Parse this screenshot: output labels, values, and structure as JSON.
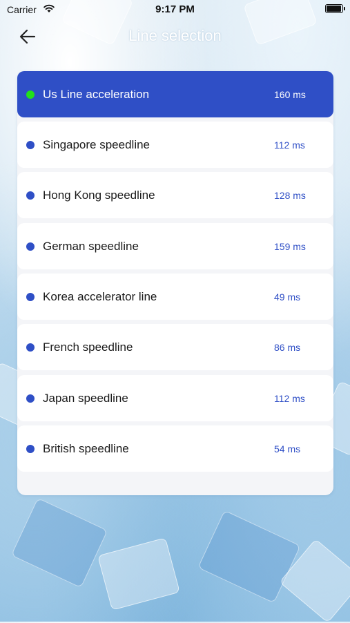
{
  "status_bar": {
    "carrier": "Carrier",
    "time": "9:17 PM"
  },
  "nav": {
    "title": "Line selection"
  },
  "lines": [
    {
      "name": "Us Line acceleration",
      "latency": "160 ms",
      "selected": true
    },
    {
      "name": "Singapore speedline",
      "latency": "112 ms",
      "selected": false
    },
    {
      "name": "Hong Kong speedline",
      "latency": "128 ms",
      "selected": false
    },
    {
      "name": "German speedline",
      "latency": "159 ms",
      "selected": false
    },
    {
      "name": "Korea accelerator line",
      "latency": "49 ms",
      "selected": false
    },
    {
      "name": "French speedline",
      "latency": "86 ms",
      "selected": false
    },
    {
      "name": "Japan speedline",
      "latency": "112 ms",
      "selected": false
    },
    {
      "name": "British speedline",
      "latency": "54 ms",
      "selected": false
    }
  ],
  "colors": {
    "accent": "#2f4fc6",
    "selected_dot": "#22e01a",
    "card": "#ffffff",
    "panel": "#f4f5f8"
  },
  "icons": {
    "back": "arrow-left-icon",
    "wifi": "wifi-icon",
    "battery": "battery-icon"
  }
}
